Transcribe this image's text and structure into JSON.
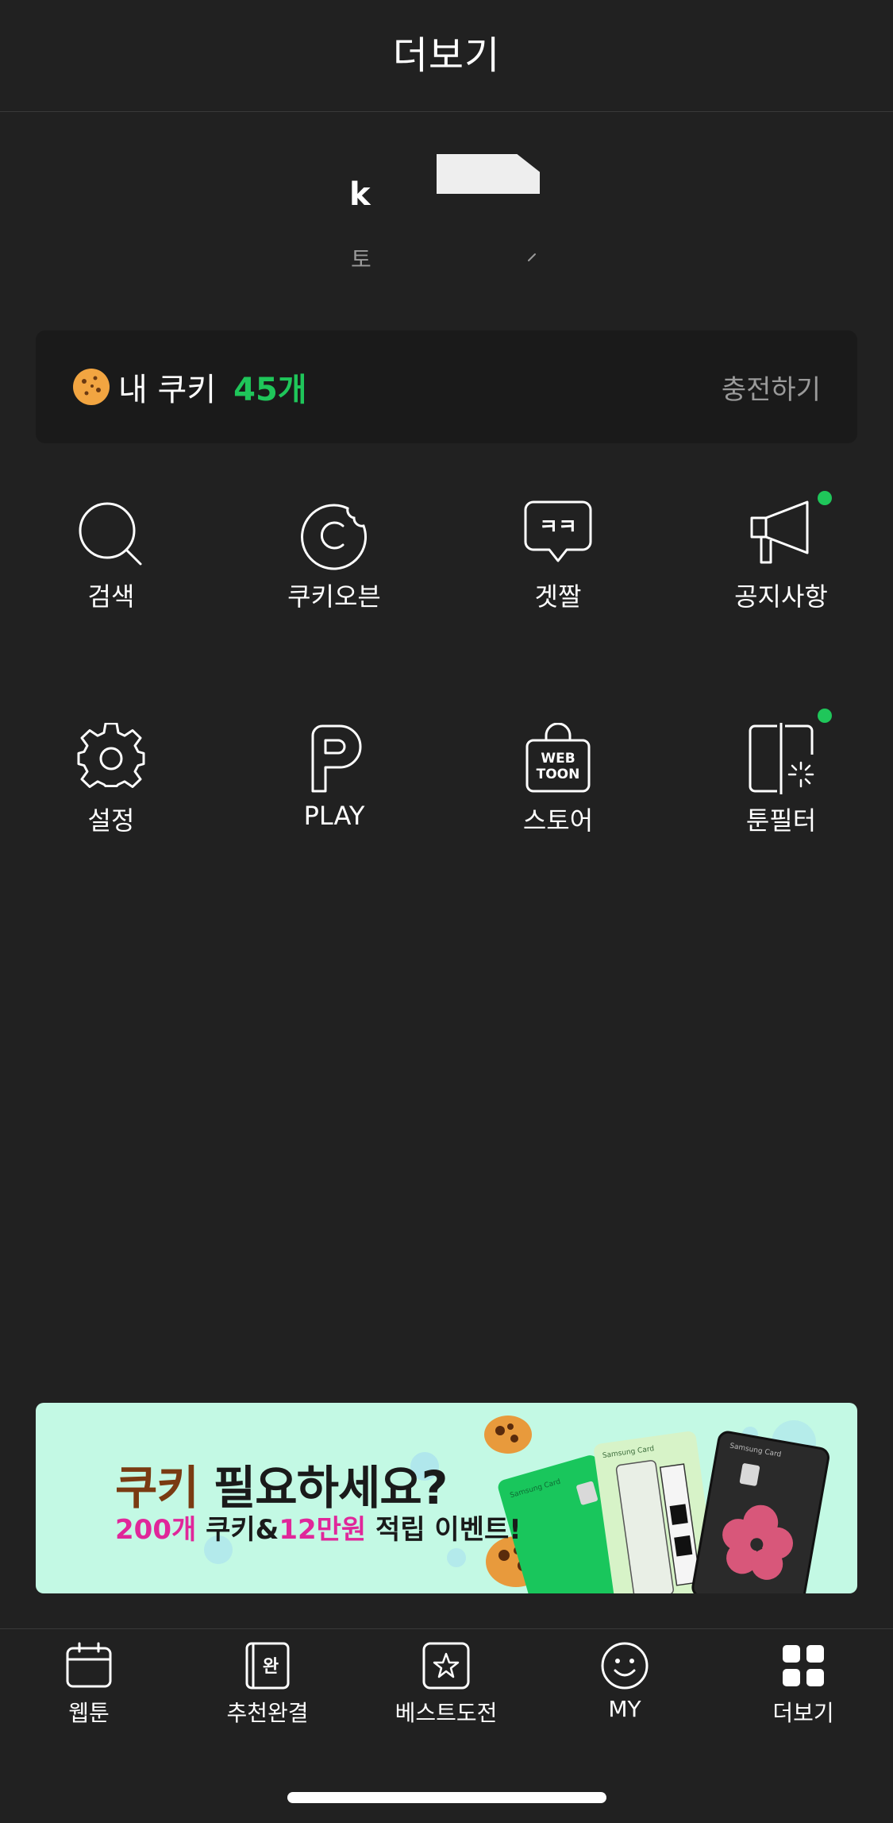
{
  "header": {
    "title": "더보기"
  },
  "profile": {
    "name_partial": "k",
    "subtitle_partial": "토"
  },
  "cookies": {
    "label": "내 쿠키",
    "count": "45개",
    "charge_label": "충전하기",
    "count_color": "#1fc65a"
  },
  "menu": {
    "row1": [
      {
        "label": "검색",
        "icon": "search-icon"
      },
      {
        "label": "쿠키오븐",
        "icon": "cookie-oven-icon"
      },
      {
        "label": "겟짤",
        "icon": "speech-bubble-icon"
      },
      {
        "label": "공지사항",
        "icon": "megaphone-icon",
        "new": true
      }
    ],
    "row2": [
      {
        "label": "설정",
        "icon": "gear-icon"
      },
      {
        "label": "PLAY",
        "icon": "play-p-icon"
      },
      {
        "label": "스토어",
        "icon": "shopping-bag-icon"
      },
      {
        "label": "툰필터",
        "icon": "toon-filter-icon",
        "new": true
      }
    ],
    "speech_bubble_text": "ㅋㅋ",
    "store_bag_text_1": "WEB",
    "store_bag_text_2": "TOON"
  },
  "banner": {
    "line1_accent": "쿠키",
    "line1_rest": " 필요하세요?",
    "line2_count": "200개",
    "line2_mid": " 쿠키&",
    "line2_amount": "12만원",
    "line2_rest": " 적립 이벤트!",
    "card_brand": "Samsung Card"
  },
  "tabbar": {
    "items": [
      {
        "label": "웹툰",
        "icon": "calendar-icon"
      },
      {
        "label": "추천완결",
        "icon": "book-complete-icon",
        "badge": "완"
      },
      {
        "label": "베스트도전",
        "icon": "star-icon"
      },
      {
        "label": "MY",
        "icon": "smile-icon"
      },
      {
        "label": "더보기",
        "icon": "grid-icon"
      }
    ]
  },
  "colors": {
    "background": "#212121",
    "accent_green": "#1fc65a",
    "banner_bg": "#c3f9e4"
  }
}
